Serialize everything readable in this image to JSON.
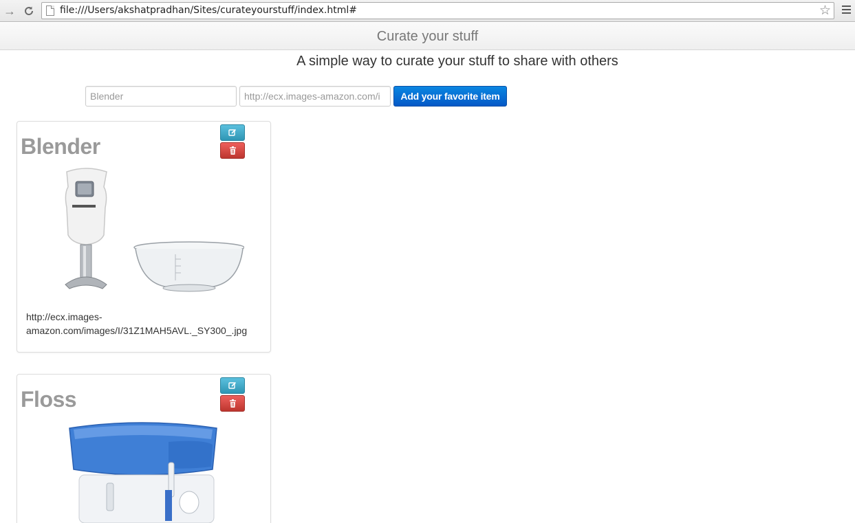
{
  "browser": {
    "url": "file:///Users/akshatpradhan/Sites/curateyourstuff/index.html#"
  },
  "header": {
    "title": "Curate your stuff"
  },
  "subtitle": "A simple way to curate your stuff to share with others",
  "form": {
    "name_value": "",
    "name_placeholder": "Blender",
    "url_value": "",
    "url_placeholder": "http://ecx.images-amazon.com/i",
    "submit_label": "Add your favorite item"
  },
  "items": [
    {
      "title": "Blender",
      "image_url": "http://ecx.images-amazon.com/images/I/31Z1MAH5AVL._SY300_.jpg",
      "url_line1": "http://ecx.images-",
      "url_line2": "amazon.com/images/I/31Z1MAH5AVL._SY300_.jpg"
    },
    {
      "title": "Floss"
    }
  ],
  "colors": {
    "primary_button": "#0a6fd6",
    "edit_button": "#49afcd",
    "delete_button": "#da4f49",
    "card_title": "#9a9a9a"
  },
  "icons": {
    "back": "back-arrow-icon",
    "reload": "reload-icon",
    "bookmark": "star-icon",
    "menu": "menu-icon",
    "edit": "edit-icon",
    "delete": "trash-icon"
  }
}
